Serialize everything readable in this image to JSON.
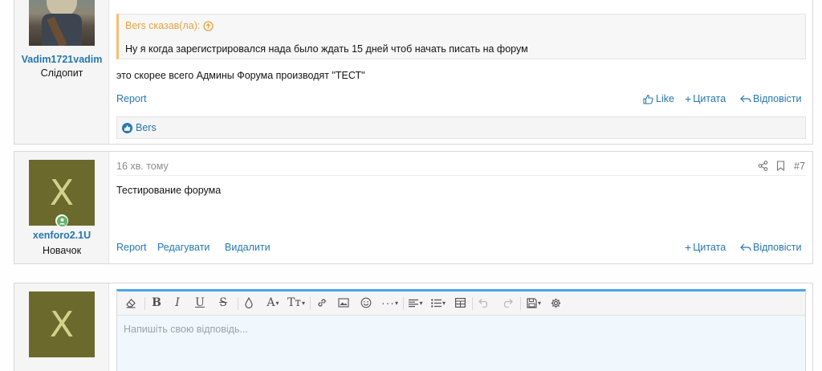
{
  "post_top": {
    "username": "Vadim1721vadim",
    "user_title": "Слідопит",
    "quote": {
      "author": "Bers сказав(ла):",
      "text": "Ну я когда зарегистрировался нада было ждать 15 дней чтоб начать писать на форум"
    },
    "message": "это скорее всего Админы Форума производят \"ТЕСТ\"",
    "actions": {
      "report": "Report",
      "like": "Like",
      "quote": "Цитата",
      "reply": "Відповісти"
    },
    "reactions_user": "Bers"
  },
  "post_7": {
    "avatar_letter": "X",
    "username": "xenforo2.1U",
    "user_title": "Новачок",
    "time": "16 хв. тому",
    "number": "#7",
    "message": "Тестирование форума",
    "actions": {
      "report": "Report",
      "edit": "Редагувати",
      "delete": "Видалити",
      "quote": "Цитата",
      "reply": "Відповісти"
    }
  },
  "reply_box": {
    "avatar_letter": "X",
    "placeholder": "Напишіть свою відповідь..."
  },
  "colors": {
    "link": "#2577b1",
    "quote_accent": "#f9bc6d",
    "avatar_bg": "#6b6a2c",
    "online_dot": "#63b265",
    "editor_top_border": "#47a7eb"
  }
}
